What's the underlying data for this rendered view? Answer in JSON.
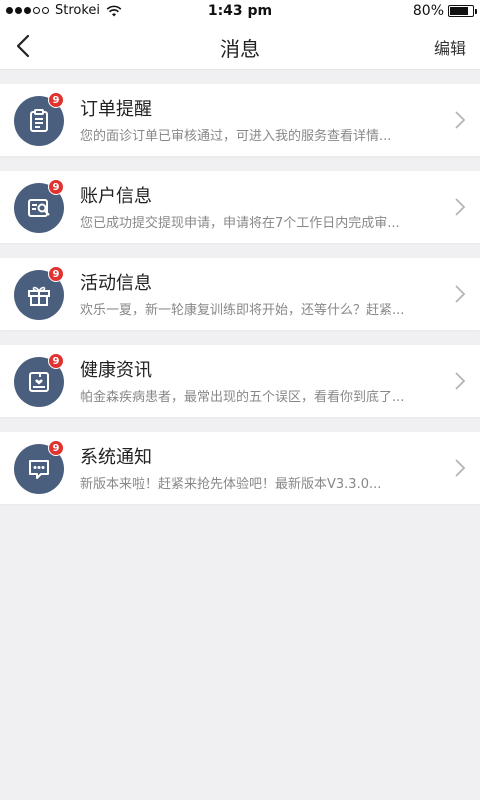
{
  "status_bar": {
    "carrier": "Strokei",
    "time": "1:43 pm",
    "battery": "80%",
    "battery_level": 0.8
  },
  "nav": {
    "title": "消息",
    "edit_label": "编辑",
    "back_icon": "chevron-left-icon"
  },
  "colors": {
    "avatar_bg": "#4a5f7e",
    "badge_bg": "#e0322f",
    "page_bg": "#f0f0f2"
  },
  "messages": [
    {
      "title": "订单提醒",
      "preview": "您的面诊订单已审核通过，可进入我的服务查看详情...",
      "badge": "9",
      "icon": "clipboard-icon"
    },
    {
      "title": "账户信息",
      "preview": "您已成功提交提现申请，申请将在7个工作日内完成审...",
      "badge": "9",
      "icon": "account-card-icon"
    },
    {
      "title": "活动信息",
      "preview": "欢乐一夏，新一轮康复训练即将开始，还等什么？赶紧...",
      "badge": "9",
      "icon": "gift-icon"
    },
    {
      "title": "健康资讯",
      "preview": "帕金森疾病患者，最常出现的五个误区，看看你到底了...",
      "badge": "9",
      "icon": "health-news-icon"
    },
    {
      "title": "系统通知",
      "preview": "新版本来啦！赶紧来抢先体验吧！最新版本V3.3.0...",
      "badge": "9",
      "icon": "chat-bubble-icon"
    }
  ]
}
